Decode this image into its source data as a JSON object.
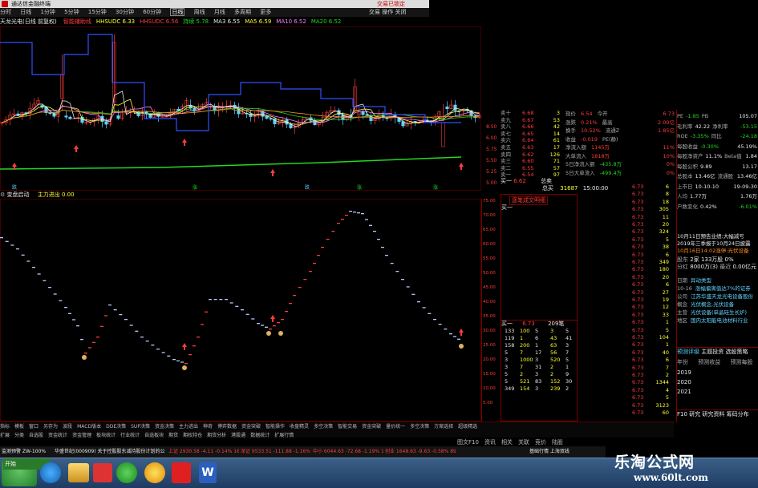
{
  "app": {
    "title": "通达信金融终端",
    "trade_label": "交易已锁定",
    "trade_tools": [
      "交易",
      "操作",
      "关闭"
    ]
  },
  "menu": [
    "系统",
    "功能",
    "行情",
    "市场",
    "资讯",
    "发现",
    "工具",
    "交易"
  ],
  "periods": [
    "分时",
    "日线",
    "1分钟",
    "5分钟",
    "15分钟",
    "30分钟",
    "60分钟",
    "日线",
    "周线",
    "月线",
    "多周期",
    "更多"
  ],
  "stock_header": "天龙光电(日线 前复权)",
  "ma_line": [
    {
      "text": "智能辅助线",
      "color": "#ff3c3c"
    },
    {
      "text": "HHSUDC 6.33",
      "color": "#ffff33"
    },
    {
      "text": "HHSUDC 6.56",
      "color": "#ff3c3c"
    },
    {
      "text": "持续 5.78",
      "color": "#22d822"
    },
    {
      "text": "MA3 6.55",
      "color": "#e8e8e8"
    },
    {
      "text": "MA5 6.59",
      "color": "#ffff33"
    },
    {
      "text": "MA10 6.52",
      "color": "#ff7fff"
    },
    {
      "text": "MA20 6.52",
      "color": "#22d822"
    }
  ],
  "price_ticks": [
    "8.50",
    "6.00",
    "5.75",
    "5.50",
    "5.25",
    "5.00"
  ],
  "indicator_header": {
    "name": "变盘启动",
    "label": "主力进出",
    "value": "0.00"
  },
  "indicator_ticks": [
    "75.00",
    "70.00",
    "65.00",
    "60.00",
    "55.00",
    "50.00",
    "45.00",
    "40.00",
    "35.00",
    "30.00",
    "25.00",
    "20.00",
    "15.00",
    "10.00",
    "5.00"
  ],
  "order_book": {
    "sell": [
      {
        "label": "卖十",
        "price": "6.68",
        "vol": "3"
      },
      {
        "label": "卖九",
        "price": "6.67",
        "vol": "53"
      },
      {
        "label": "卖八",
        "price": "6.66",
        "vol": "42"
      },
      {
        "label": "卖七",
        "price": "6.65",
        "vol": "14"
      },
      {
        "label": "卖六",
        "price": "6.64",
        "vol": "61"
      },
      {
        "label": "卖五",
        "price": "6.63",
        "vol": "17"
      },
      {
        "label": "卖四",
        "price": "6.62",
        "vol": "126"
      },
      {
        "label": "卖三",
        "price": "6.60",
        "vol": "71"
      },
      {
        "label": "卖二",
        "price": "6.55",
        "vol": "57"
      },
      {
        "label": "卖一",
        "price": "6.54",
        "vol": "97"
      }
    ],
    "buy_label": "买一",
    "buy_price": "6.62",
    "total_buy": "总买",
    "total_buy_val": "31687",
    "total_sell": "总卖",
    "time_label": "15:00:00"
  },
  "quote_stats": [
    {
      "k": "现价",
      "v": "6.54",
      "k2": "今开",
      "v2": "6.73"
    },
    {
      "k": "涨跌",
      "v": "0.21%",
      "k2": "最高",
      "v2": "2.00亿"
    },
    {
      "k": "换手",
      "v": "10.52%",
      "k2": "流通Z",
      "v2": "1.85亿"
    },
    {
      "k": "收益",
      "v": "-0.019",
      "k2": "PE(静)",
      "v2": ""
    },
    {
      "k": "净流入额",
      "v": "1145万",
      "v2": "11%"
    },
    {
      "k": "大单流入",
      "v": "1818万",
      "v2": "10%"
    },
    {
      "k": "5日净流入额",
      "v": "-435.8万",
      "v2": "0%"
    },
    {
      "k": "5日大单流入",
      "v": "-499.4万",
      "v2": "0%"
    }
  ],
  "f10": [
    {
      "k": "PE",
      "v": "-1.85",
      "k2": "PB",
      "v2": "105.07"
    },
    {
      "k": "毛利率",
      "v": "42.22",
      "k2": "净利率",
      "v2": "-53.15"
    },
    {
      "k": "ROE",
      "v": "-3.35%",
      "k2": "同比",
      "v2": "-24.18"
    },
    {
      "k": "每股收益",
      "v": "-0.30%",
      "k2": "",
      "v2": "45.19%"
    },
    {
      "k": "每股净资产",
      "v": "11.1%",
      "k2": "Beta值",
      "v2": "1.84"
    },
    {
      "k": "每股公积",
      "v": "9.89",
      "k2": "",
      "v2": "13.17"
    },
    {
      "k": "总股本",
      "v": "13.46亿",
      "k2": "流通股",
      "v2": "13.46亿"
    },
    {
      "k": "上市日",
      "v": "10-10-10",
      "k2": "",
      "v2": "19-09-30"
    },
    {
      "k": "人均",
      "v": "1.77万",
      "k2": "",
      "v2": "1.76万"
    },
    {
      "k": "户数变化",
      "v": "0.42%",
      "k2": "",
      "v2": "-6.01%"
    }
  ],
  "news": [
    "10月11日预告业绩:大幅减亏",
    "2019年三季报于10月24日披露",
    "10月16日14:02涨停:光伏设备"
  ],
  "shareholder": {
    "k1": "股东",
    "v1": "2家",
    "v2": "133万股",
    "v3": "0%",
    "k2": "分红",
    "v4": "8000万(3)",
    "v5": "最近",
    "v6": "0.00亿元"
  },
  "events": [
    {
      "k": "日期",
      "v": "异动类型"
    },
    {
      "k": "10-16",
      "v": "涨幅偏离值达7%的证券"
    },
    {
      "k": "公司",
      "v": "江苏华盛天龙光电设备股份"
    },
    {
      "k": "概念",
      "v": "光伏概念,光伏设备"
    },
    {
      "k": "主营",
      "v": "光伏设备(单晶硅生长炉)"
    },
    {
      "k": "地区",
      "v": "国内太阳能电池材料行业"
    }
  ],
  "forecast_tabs": [
    "预测评级",
    "主题投资",
    "选股策略"
  ],
  "forecast_years": [
    "年份",
    "预测收益",
    "预测每股"
  ],
  "years": [
    "2019",
    "2020",
    "2021"
  ],
  "right_tabs_bottom": [
    "F10",
    "研究",
    "研究资料",
    "筹码分布"
  ],
  "bid_ladder_label": "逐笔成交明细",
  "bid_price_col": [
    "6.73"
  ],
  "level2_header": {
    "label": "买一",
    "price": "6.73",
    "vol": "209笔"
  },
  "level2_rows": [
    [
      "133",
      "100",
      "5",
      "3",
      "5"
    ],
    [
      "119",
      "1",
      "6",
      "43",
      "41"
    ],
    [
      "158",
      "200",
      "1",
      "63",
      "3"
    ],
    [
      "5",
      "7",
      "17",
      "56",
      "7"
    ],
    [
      "3",
      "1000",
      "3",
      "520",
      "5"
    ],
    [
      "3",
      "7",
      "31",
      "2",
      "1"
    ],
    [
      "5",
      "2",
      "3",
      "2",
      "9"
    ],
    [
      "5",
      "521",
      "83",
      "152",
      "30"
    ],
    [
      "349",
      "154",
      "3",
      "239",
      "2"
    ]
  ],
  "ticks": [
    {
      "p": "6.73",
      "v": "6"
    },
    {
      "p": "6.73",
      "v": "8"
    },
    {
      "p": "6.73",
      "v": "18"
    },
    {
      "p": "6.73",
      "v": "305"
    },
    {
      "p": "6.73",
      "v": "11"
    },
    {
      "p": "6.73",
      "v": "20"
    },
    {
      "p": "6.73",
      "v": "324"
    },
    {
      "p": "6.73",
      "v": "5"
    },
    {
      "p": "6.73",
      "v": "38"
    },
    {
      "p": "6.73",
      "v": "6"
    },
    {
      "p": "6.73",
      "v": "349"
    },
    {
      "p": "6.73",
      "v": "180"
    },
    {
      "p": "6.73",
      "v": "20"
    },
    {
      "p": "6.73",
      "v": "6"
    },
    {
      "p": "6.73",
      "v": "27"
    },
    {
      "p": "6.73",
      "v": "19"
    },
    {
      "p": "6.73",
      "v": "12"
    },
    {
      "p": "6.73",
      "v": "33"
    },
    {
      "p": "6.73",
      "v": "1"
    },
    {
      "p": "6.73",
      "v": "5"
    },
    {
      "p": "6.73",
      "v": "104"
    },
    {
      "p": "6.73",
      "v": "1"
    },
    {
      "p": "6.73",
      "v": "40"
    },
    {
      "p": "6.73",
      "v": "6"
    },
    {
      "p": "6.73",
      "v": "7"
    },
    {
      "p": "6.73",
      "v": "2"
    },
    {
      "p": "6.73",
      "v": "1344"
    },
    {
      "p": "6.73",
      "v": "4"
    },
    {
      "p": "6.73",
      "v": "5"
    },
    {
      "p": "6.73",
      "v": "3123"
    },
    {
      "p": "6.73",
      "v": "60"
    }
  ],
  "bottom_tabs_row1": [
    "指标",
    "模板",
    "窗口",
    "另存为",
    "波段",
    "MACD版本",
    "DDE决策",
    "SUP决策",
    "资金决策",
    "主力进出",
    "神奇",
    "博弈数据",
    "资金突破",
    "智能操作",
    "收盘精灵",
    "多空决策",
    "智能交易",
    "资金突破",
    "量价统一",
    "多空决策",
    "方案选择",
    "超级精选"
  ],
  "bottom_tabs_row2": [
    "扩展",
    "分类",
    "自选股",
    "资金统计",
    "资金管理",
    "板块统计",
    "行业统计",
    "自选板块",
    "期货",
    "期权持仓",
    "期货分析",
    "港股通",
    "数据统计",
    "扩展行情"
  ],
  "bottom_right_tabs": [
    "图文F10",
    "资讯",
    "相关",
    "关联",
    "竞价",
    "陆股"
  ],
  "status_items": [
    "监测预警 ZW-100%",
    "华盛世纪(000909) 关于控股股东减持股份计划的公告",
    "上证 2930.58 -4.11 -0.14% 1620亿",
    "深证 9533.51 -111.88 -1.16% 2038亿",
    "中小 6044.63 -72.68 -1.19% 1090亿",
    "创业 1648.63 -9.63 -0.58% 893亿"
  ],
  "status_right": "基础行情 上海双线",
  "watermark": {
    "line1": "乐淘公式网",
    "line2": "www.60lt.com"
  },
  "taskbar_items": [
    "开始",
    "IE浏览器",
    "文件管理器",
    "浏览器",
    "360",
    "WPS",
    "Word"
  ],
  "signals_row": [
    "跌",
    "涨",
    "跌",
    "涨",
    "涨"
  ]
}
